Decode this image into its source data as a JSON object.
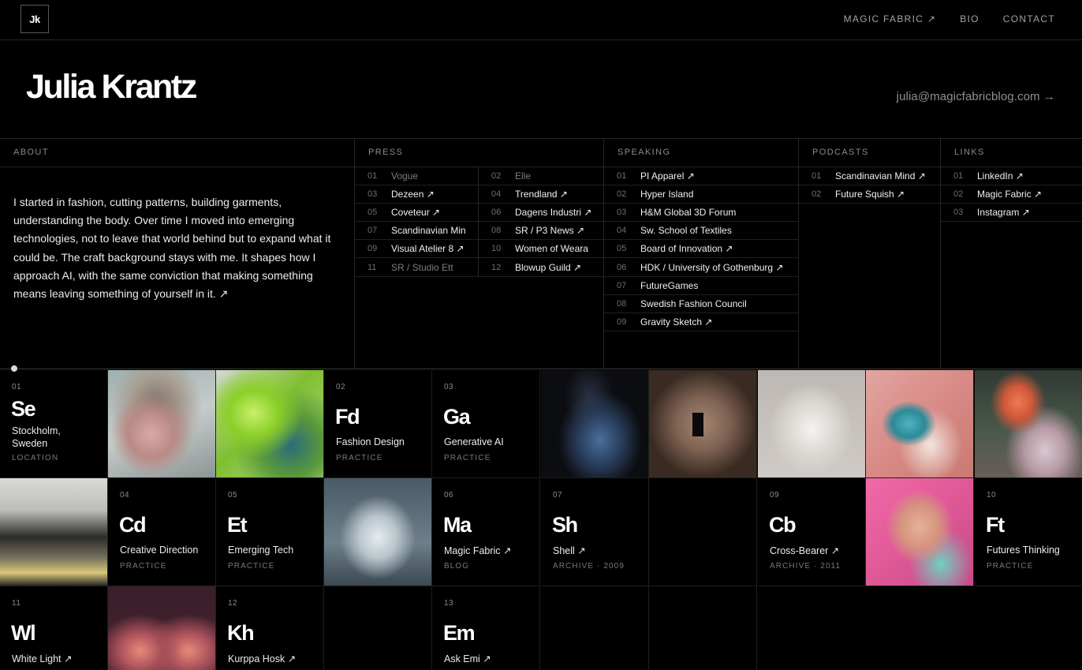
{
  "nav": {
    "logo": "Jk",
    "links": [
      "MAGIC FABRIC ↗",
      "BIO",
      "CONTACT"
    ]
  },
  "hero": {
    "name": "Julia Krantz",
    "email": "julia@magicfabricblog.com →"
  },
  "about": {
    "heading": "ABOUT",
    "text": "I started in fashion, cutting patterns, building garments, understanding the body. Over time I moved into emerging technologies, not to leave that world behind but to expand what it could be. The craft background stays with me. It shapes how I approach AI, with the same conviction that making something means leaving something of yourself in it. ↗"
  },
  "press": {
    "heading": "PRESS",
    "items": [
      {
        "num": "01",
        "label": "Vogue"
      },
      {
        "num": "02",
        "label": "Elle"
      },
      {
        "num": "03",
        "label": "Dezeen ↗"
      },
      {
        "num": "04",
        "label": "Trendland ↗"
      },
      {
        "num": "05",
        "label": "Coveteur ↗"
      },
      {
        "num": "06",
        "label": "Dagens Industri ↗"
      },
      {
        "num": "07",
        "label": "Scandinavian Min"
      },
      {
        "num": "08",
        "label": "SR / P3 News ↗"
      },
      {
        "num": "09",
        "label": "Visual Atelier 8 ↗"
      },
      {
        "num": "10",
        "label": "Women of Weara"
      },
      {
        "num": "11",
        "label": "SR / Studio Ett"
      },
      {
        "num": "12",
        "label": "Blowup Guild ↗"
      }
    ]
  },
  "speaking": {
    "heading": "SPEAKING",
    "items": [
      {
        "num": "01",
        "label": "PI Apparel ↗"
      },
      {
        "num": "02",
        "label": "Hyper Island"
      },
      {
        "num": "03",
        "label": "H&M Global 3D Forum"
      },
      {
        "num": "04",
        "label": "Sw. School of Textiles"
      },
      {
        "num": "05",
        "label": "Board of Innovation ↗"
      },
      {
        "num": "06",
        "label": "HDK / University of Gothenburg ↗"
      },
      {
        "num": "07",
        "label": "FutureGames"
      },
      {
        "num": "08",
        "label": "Swedish Fashion Council"
      },
      {
        "num": "09",
        "label": "Gravity Sketch ↗"
      }
    ]
  },
  "podcasts": {
    "heading": "PODCASTS",
    "items": [
      {
        "num": "01",
        "label": "Scandinavian Mind ↗"
      },
      {
        "num": "02",
        "label": "Future Squish ↗"
      }
    ]
  },
  "links": {
    "heading": "LINKS",
    "items": [
      {
        "num": "01",
        "label": "LinkedIn ↗"
      },
      {
        "num": "02",
        "label": "Magic Fabric ↗"
      },
      {
        "num": "03",
        "label": "Instagram ↗"
      }
    ]
  },
  "tiles": {
    "t01": {
      "num": "01",
      "sym": "Se",
      "name": "Stockholm, Sweden",
      "cat": "LOCATION"
    },
    "t02": {
      "num": "02",
      "sym": "Fd",
      "name": "Fashion Design",
      "cat": "PRACTICE"
    },
    "t03": {
      "num": "03",
      "sym": "Ga",
      "name": "Generative AI",
      "cat": "PRACTICE"
    },
    "t04": {
      "num": "04",
      "sym": "Cd",
      "name": "Creative Direction",
      "cat": "PRACTICE"
    },
    "t05": {
      "num": "05",
      "sym": "Et",
      "name": "Emerging Tech",
      "cat": "PRACTICE"
    },
    "t06": {
      "num": "06",
      "sym": "Ma",
      "name": "Magic Fabric ↗",
      "cat": "BLOG"
    },
    "t07": {
      "num": "07",
      "sym": "Sh",
      "name": "Shell ↗",
      "cat": "ARCHIVE · 2009"
    },
    "t09": {
      "num": "09",
      "sym": "Cb",
      "name": "Cross-Bearer ↗",
      "cat": "ARCHIVE · 2011"
    },
    "t10": {
      "num": "10",
      "sym": "Ft",
      "name": "Futures Thinking",
      "cat": "PRACTICE"
    },
    "t11": {
      "num": "11",
      "sym": "Wl",
      "name": "White Light ↗",
      "cat": ""
    },
    "t12": {
      "num": "12",
      "sym": "Kh",
      "name": "Kurppa Hosk ↗",
      "cat": ""
    },
    "t13": {
      "num": "13",
      "sym": "Em",
      "name": "Ask Emi ↗",
      "cat": ""
    }
  }
}
